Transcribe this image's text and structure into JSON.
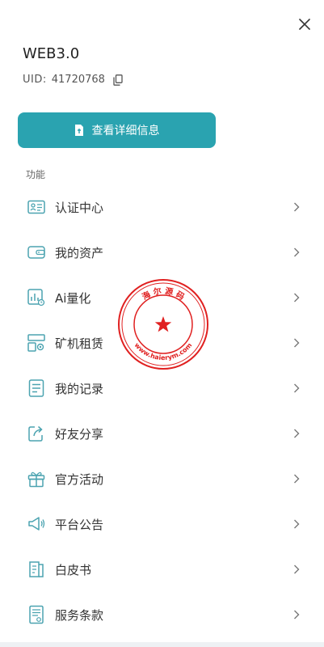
{
  "header": {
    "title": "WEB3.0",
    "uid_label": "UID:",
    "uid_value": "41720768"
  },
  "detail_button": {
    "label": "查看详细信息"
  },
  "section": {
    "label": "功能"
  },
  "menu": [
    {
      "label": "认证中心",
      "icon": "id-card-icon"
    },
    {
      "label": "我的资产",
      "icon": "wallet-icon"
    },
    {
      "label": "Ai量化",
      "icon": "chart-icon"
    },
    {
      "label": "矿机租赁",
      "icon": "miner-icon"
    },
    {
      "label": "我的记录",
      "icon": "record-icon"
    },
    {
      "label": "好友分享",
      "icon": "share-icon"
    },
    {
      "label": "官方活动",
      "icon": "gift-icon"
    },
    {
      "label": "平台公告",
      "icon": "megaphone-icon"
    },
    {
      "label": "白皮书",
      "icon": "book-icon"
    },
    {
      "label": "服务条款",
      "icon": "terms-icon"
    }
  ],
  "watermark": {
    "top_text": "海 尔 源 码",
    "bottom_text": "www.haierym.com"
  },
  "colors": {
    "accent": "#2aa3b0",
    "icon": "#4ba3b0",
    "stamp": "#e02020"
  }
}
